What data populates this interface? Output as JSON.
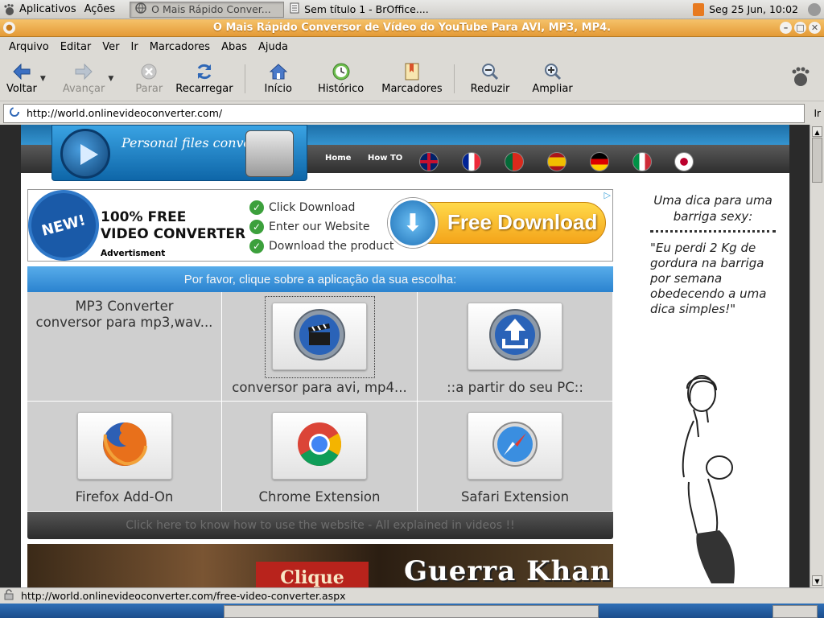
{
  "top_panel": {
    "menu_apps": "Aplicativos",
    "menu_actions": "Ações",
    "tasks": [
      {
        "label": "O Mais Rápido Conver...",
        "active": true
      },
      {
        "label": "Sem título 1 - BrOffice....",
        "active": false
      }
    ],
    "clock": "Seg 25 Jun, 10:02"
  },
  "window": {
    "title": "O Mais Rápido Conversor de Vídeo do YouTube Para AVI, MP3, MP4."
  },
  "menubar": [
    "Arquivo",
    "Editar",
    "Ver",
    "Ir",
    "Marcadores",
    "Abas",
    "Ajuda"
  ],
  "toolbar": {
    "back": "Voltar",
    "forward": "Avançar",
    "stop": "Parar",
    "reload": "Recarregar",
    "home": "Início",
    "history": "Histórico",
    "bookmarks": "Marcadores",
    "zoom_out": "Reduzir",
    "zoom_in": "Ampliar"
  },
  "location": {
    "url": "http://world.onlinevideoconverter.com/",
    "go": "Ir"
  },
  "site": {
    "logo_text": "Personal files converter",
    "nav": [
      "Home",
      "How TO"
    ],
    "flags": [
      "uk",
      "france",
      "portugal",
      "spain",
      "germany",
      "italy",
      "japan"
    ]
  },
  "ad_banner": {
    "badge": "NEW!",
    "headline_1": "100% FREE",
    "headline_2": "VIDEO CONVERTER",
    "advertisment": "Advertisment",
    "checks": [
      "Click Download",
      "Enter our Website",
      "Download the product"
    ],
    "cta": "Free Download"
  },
  "choices": {
    "header": "Por favor, clique sobre a aplicação da sua escolha:",
    "cells": [
      {
        "line1": "MP3 Converter",
        "line2": "conversor para mp3,wav..."
      },
      {
        "caption": "conversor para avi, mp4..."
      },
      {
        "caption": "::a partir do seu PC::"
      },
      {
        "caption": "Firefox Add-On"
      },
      {
        "caption": "Chrome Extension"
      },
      {
        "caption": "Safari Extension"
      }
    ],
    "howto": "Click here to know how to use the website - All explained in videos !!"
  },
  "game_ad": {
    "banner": "Clique",
    "title": "Guerra Khan"
  },
  "side_ad": {
    "title": "Uma dica para uma barriga sexy:",
    "quote": "\"Eu perdi 2 Kg de gordura na barriga por semana obedecendo a uma dica simples!\""
  },
  "statusbar": {
    "url": "http://world.onlinevideoconverter.com/free-video-converter.aspx"
  }
}
